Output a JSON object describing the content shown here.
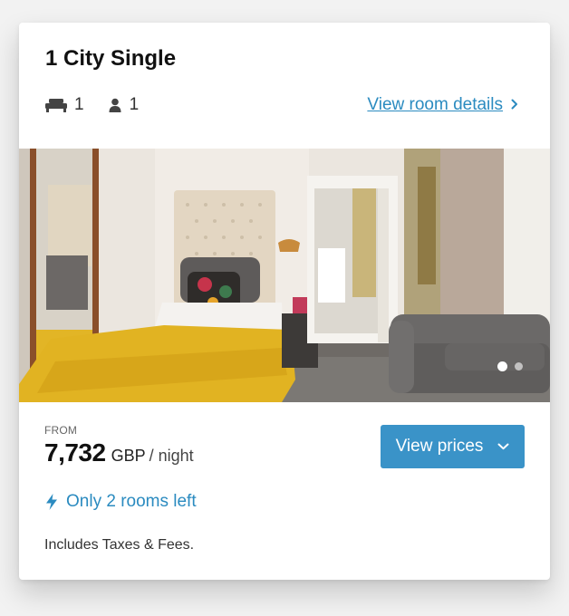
{
  "room": {
    "title": "1 City Single",
    "beds": "1",
    "guests": "1",
    "details_link": "View room details"
  },
  "gallery": {
    "image": "hotel-room-photo",
    "dots_total": 2,
    "active_index": 0
  },
  "pricing": {
    "from_label": "FROM",
    "amount": "7,732",
    "currency": "GBP",
    "unit": "/ night",
    "button_label": "View prices"
  },
  "availability": {
    "message": "Only 2 rooms left"
  },
  "footer": {
    "taxes_note": "Includes Taxes & Fees."
  },
  "colors": {
    "accent": "#2b8bc0",
    "button": "#3a93c8"
  }
}
